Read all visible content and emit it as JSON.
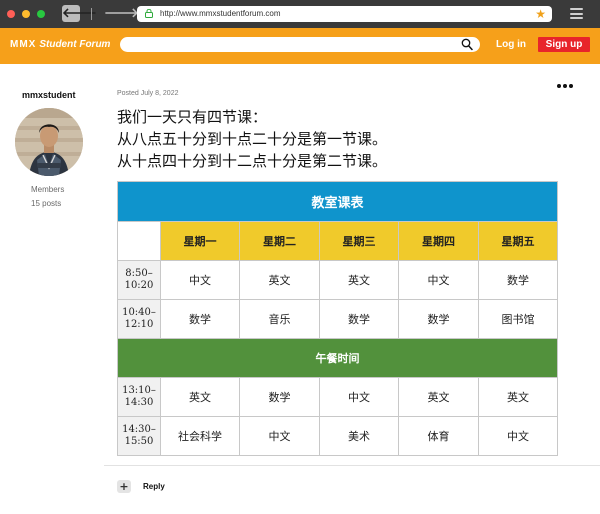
{
  "browser": {
    "url": "http://www.mmxstudentforum.com",
    "back_glyph": "🡐",
    "forward_glyph": "🡒",
    "star_glyph": "★"
  },
  "header": {
    "brand_mark": "MMX",
    "brand_name": "Student Forum",
    "login_label": "Log in",
    "signup_label": "Sign up",
    "accent_color": "#f6a01a",
    "signup_color": "#e8242a"
  },
  "user": {
    "name": "mmxstudent",
    "role": "Members",
    "posts": "15 posts"
  },
  "post": {
    "posted": "Posted July 8, 2022",
    "lines": [
      "我们一天只有四节课：",
      "从八点五十分到十点二十分是第一节课。",
      "从十点四十分到十二点十分是第二节课。"
    ]
  },
  "timetable": {
    "title": "教室课表",
    "days": [
      "星期一",
      "星期二",
      "星期三",
      "星期四",
      "星期五"
    ],
    "morning": [
      {
        "time": [
          "8:50–",
          "10:20"
        ],
        "cells": [
          "中文",
          "英文",
          "英文",
          "中文",
          "数学"
        ]
      },
      {
        "time": [
          "10:40–",
          "12:10"
        ],
        "cells": [
          "数学",
          "音乐",
          "数学",
          "数学",
          "图书馆"
        ]
      }
    ],
    "lunch": "午餐时间",
    "afternoon": [
      {
        "time": [
          "13:10–",
          "14:30"
        ],
        "cells": [
          "英文",
          "数学",
          "中文",
          "英文",
          "英文"
        ]
      },
      {
        "time": [
          "14:30–",
          "15:50"
        ],
        "cells": [
          "社会科学",
          "中文",
          "美术",
          "体育",
          "中文"
        ]
      }
    ],
    "title_color": "#0f94cc",
    "header_color": "#f0ca2b",
    "lunch_color": "#52913c"
  },
  "footer": {
    "reply_plus": "+",
    "reply_label": "Reply"
  }
}
